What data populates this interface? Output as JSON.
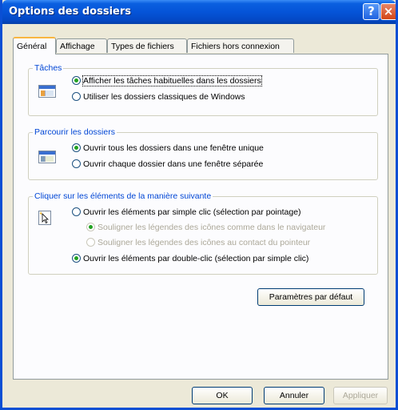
{
  "window": {
    "title": "Options des dossiers"
  },
  "titlebar": {
    "help_glyph": "?",
    "close_glyph": "×"
  },
  "tabs": [
    {
      "label": "Général"
    },
    {
      "label": "Affichage"
    },
    {
      "label": "Types de fichiers"
    },
    {
      "label": "Fichiers hors connexion"
    }
  ],
  "groups": {
    "taches": {
      "legend": "Tâches",
      "options": [
        {
          "label": "Afficher les tâches habituelles dans les dossiers",
          "checked": true
        },
        {
          "label": "Utiliser les dossiers classiques de Windows",
          "checked": false
        }
      ]
    },
    "parcourir": {
      "legend": "Parcourir les dossiers",
      "options": [
        {
          "label": "Ouvrir tous les dossiers dans une fenêtre unique",
          "checked": true
        },
        {
          "label": "Ouvrir chaque dossier dans une fenêtre séparée",
          "checked": false
        }
      ]
    },
    "cliquer": {
      "legend": "Cliquer sur les éléments de la manière suivante",
      "options": [
        {
          "label": "Ouvrir les éléments par simple clic (sélection par pointage)",
          "checked": false
        },
        {
          "label": "Souligner les légendes des icônes comme dans le navigateur",
          "checked": true
        },
        {
          "label": "Souligner les légendes des icônes au contact du pointeur",
          "checked": false
        },
        {
          "label": "Ouvrir les éléments par double-clic (sélection par simple clic)",
          "checked": true
        }
      ]
    }
  },
  "buttons": {
    "defaults": "Paramètres par défaut",
    "ok": "OK",
    "cancel": "Annuler",
    "apply": "Appliquer"
  }
}
